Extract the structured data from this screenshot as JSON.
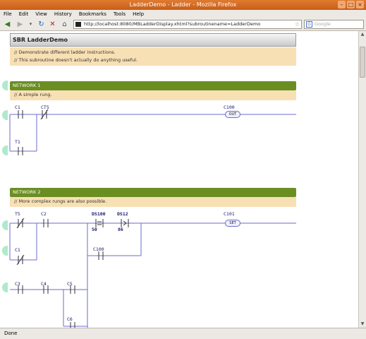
{
  "window": {
    "title": "LadderDemo - Ladder - Mozilla Firefox"
  },
  "menu": [
    "File",
    "Edit",
    "View",
    "History",
    "Bookmarks",
    "Tools",
    "Help"
  ],
  "nav": {
    "url": "http://localhost:8080/MBLadderDisplay.xhtml?subroutinename=LadderDemo",
    "search_placeholder": "Google"
  },
  "status": "Done",
  "page": {
    "sbr_title": "SBR LadderDemo",
    "intro": [
      "// Demonstrate different ladder instructions.",
      "// This subroutine doesn't actually do anything useful."
    ],
    "network1": {
      "label": "NETWORK 1",
      "comment": "// A simple rung.",
      "contacts": [
        "C1",
        "CT5",
        "T1"
      ],
      "coil": "C100",
      "coil_type": "OUT"
    },
    "network2": {
      "label": "NETWORK 2",
      "comment": "// More complex rungs are also possible.",
      "contacts": [
        "T5",
        "C2",
        "DS100",
        "DS12",
        "C1",
        "C100",
        "C3",
        "C4",
        "C5",
        "C6"
      ],
      "compare_values": [
        "50",
        "86"
      ],
      "coil": "C101",
      "coil_type": "SET"
    }
  },
  "colors": {
    "network_header": "#6b8e23",
    "comment_bg": "#f8e0b5",
    "rung_line": "#6b6bcc",
    "titlebar": "#d4682a"
  }
}
